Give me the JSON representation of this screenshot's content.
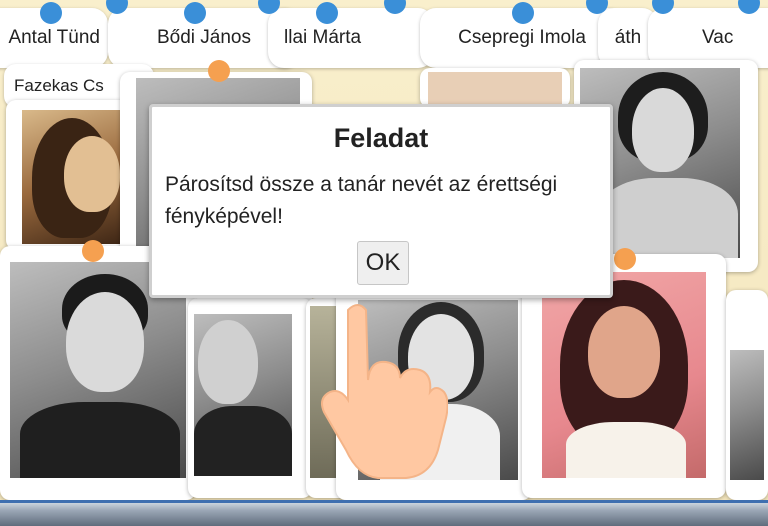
{
  "names": [
    {
      "label": "Antal Tünd",
      "dot": true
    },
    {
      "label": "Bődi János",
      "dot": true
    },
    {
      "label": "llai Márta",
      "dot": true
    },
    {
      "label": "Csepregi Imola",
      "dot": true
    },
    {
      "label": "áth",
      "dot": false
    },
    {
      "label": "Vac",
      "dot": false
    }
  ],
  "second_row_name": "Fazekas Cs",
  "dialog": {
    "title": "Feladat",
    "body": "Párosítsd össze a tanár nevét az érettségi fényképével!",
    "ok_label": "OK"
  },
  "colors": {
    "dot_blue": "#3a8fd8",
    "dot_orange": "#f5a050",
    "background": "#f7ecc8"
  },
  "icons": [
    "pointing-hand-icon"
  ]
}
